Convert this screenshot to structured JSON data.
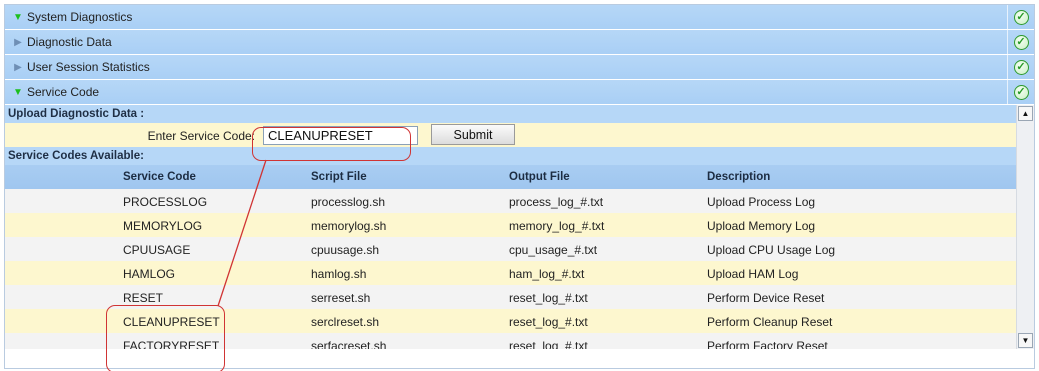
{
  "sections": [
    {
      "title": "System Diagnostics",
      "state": "expanded"
    },
    {
      "title": "Diagnostic Data",
      "state": "collapsed"
    },
    {
      "title": "User Session Statistics",
      "state": "collapsed"
    },
    {
      "title": "Service Code",
      "state": "expanded"
    }
  ],
  "upload": {
    "title": "Upload Diagnostic Data :",
    "label": "Enter Service Code:",
    "input_value": "CLEANUPRESET",
    "submit_label": "Submit"
  },
  "codes": {
    "title": "Service Codes Available:",
    "headers": [
      "Service Code",
      "Script File",
      "Output File",
      "Description"
    ],
    "rows": [
      [
        "PROCESSLOG",
        "processlog.sh",
        "process_log_#.txt",
        "Upload Process Log"
      ],
      [
        "MEMORYLOG",
        "memorylog.sh",
        "memory_log_#.txt",
        "Upload Memory Log"
      ],
      [
        "CPUUSAGE",
        "cpuusage.sh",
        "cpu_usage_#.txt",
        "Upload CPU Usage Log"
      ],
      [
        "HAMLOG",
        "hamlog.sh",
        "ham_log_#.txt",
        "Upload HAM Log"
      ],
      [
        "RESET",
        "serreset.sh",
        "reset_log_#.txt",
        "Perform Device Reset"
      ],
      [
        "CLEANUPRESET",
        "serclreset.sh",
        "reset_log_#.txt",
        "Perform Cleanup Reset"
      ],
      [
        "FACTORYRESET",
        "serfacreset.sh",
        "reset_log_#.txt",
        "Perform Factory Reset"
      ]
    ]
  },
  "icons": {
    "expanded": "triangle-down-icon",
    "collapsed": "triangle-right-icon",
    "status": "check-circle-icon",
    "scroll_up": "scroll-up-icon",
    "scroll_down": "scroll-down-icon"
  },
  "colors": {
    "header_blue": "#b6d7f7",
    "row_yellow": "#fdf7cf",
    "row_gray": "#f3f3f3",
    "expand_green": "#1dbf1d",
    "annotation_red": "#d03434"
  }
}
